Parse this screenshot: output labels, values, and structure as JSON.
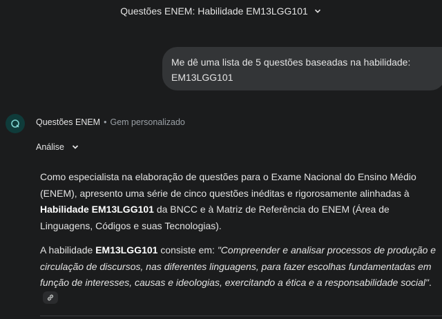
{
  "header": {
    "title": "Questões ENEM: Habilidade EM13LGG101",
    "chevron_icon": "chevron-down-icon"
  },
  "user_message": {
    "line1": "Me dê uma lista de 5 questões baseadas na habilidade:",
    "line2": "EM13LGG101"
  },
  "gem": {
    "avatar_icon": "gem-spark-icon",
    "name": "Questões ENEM",
    "separator": "•",
    "subtitle": "Gem personalizado"
  },
  "analysis": {
    "label": "Análise",
    "chevron_icon": "chevron-down-icon"
  },
  "response": {
    "p1_a": "Como especialista na elaboração de questões para o Exame Nacional do Ensino Médio (ENEM), apresento uma série de cinco questões inéditas e rigorosamente alinhadas à ",
    "p1_b": "Habilidade EM13LGG101",
    "p1_c": " da BNCC e à Matriz de Referência do ENEM (Área de Linguagens, Códigos e suas Tecnologias).",
    "p2_a": "A habilidade ",
    "p2_b": "EM13LGG101",
    "p2_c": " consiste em: ",
    "p2_d": "\"Compreender e analisar processos de produção e circulação de discursos, nas diferentes linguagens, para fazer escolhas fundamentadas em função de interesses, causas e ideologias, exercitando a ética e a responsabilidade social\"",
    "p2_e": ".",
    "link_icon": "link-icon"
  },
  "colors": {
    "background": "#1b1c1d",
    "bubble": "#333537",
    "avatar": "#0f3b3a",
    "avatar_accent": "#7fd3cf",
    "muted_text": "#9aa0a6"
  }
}
